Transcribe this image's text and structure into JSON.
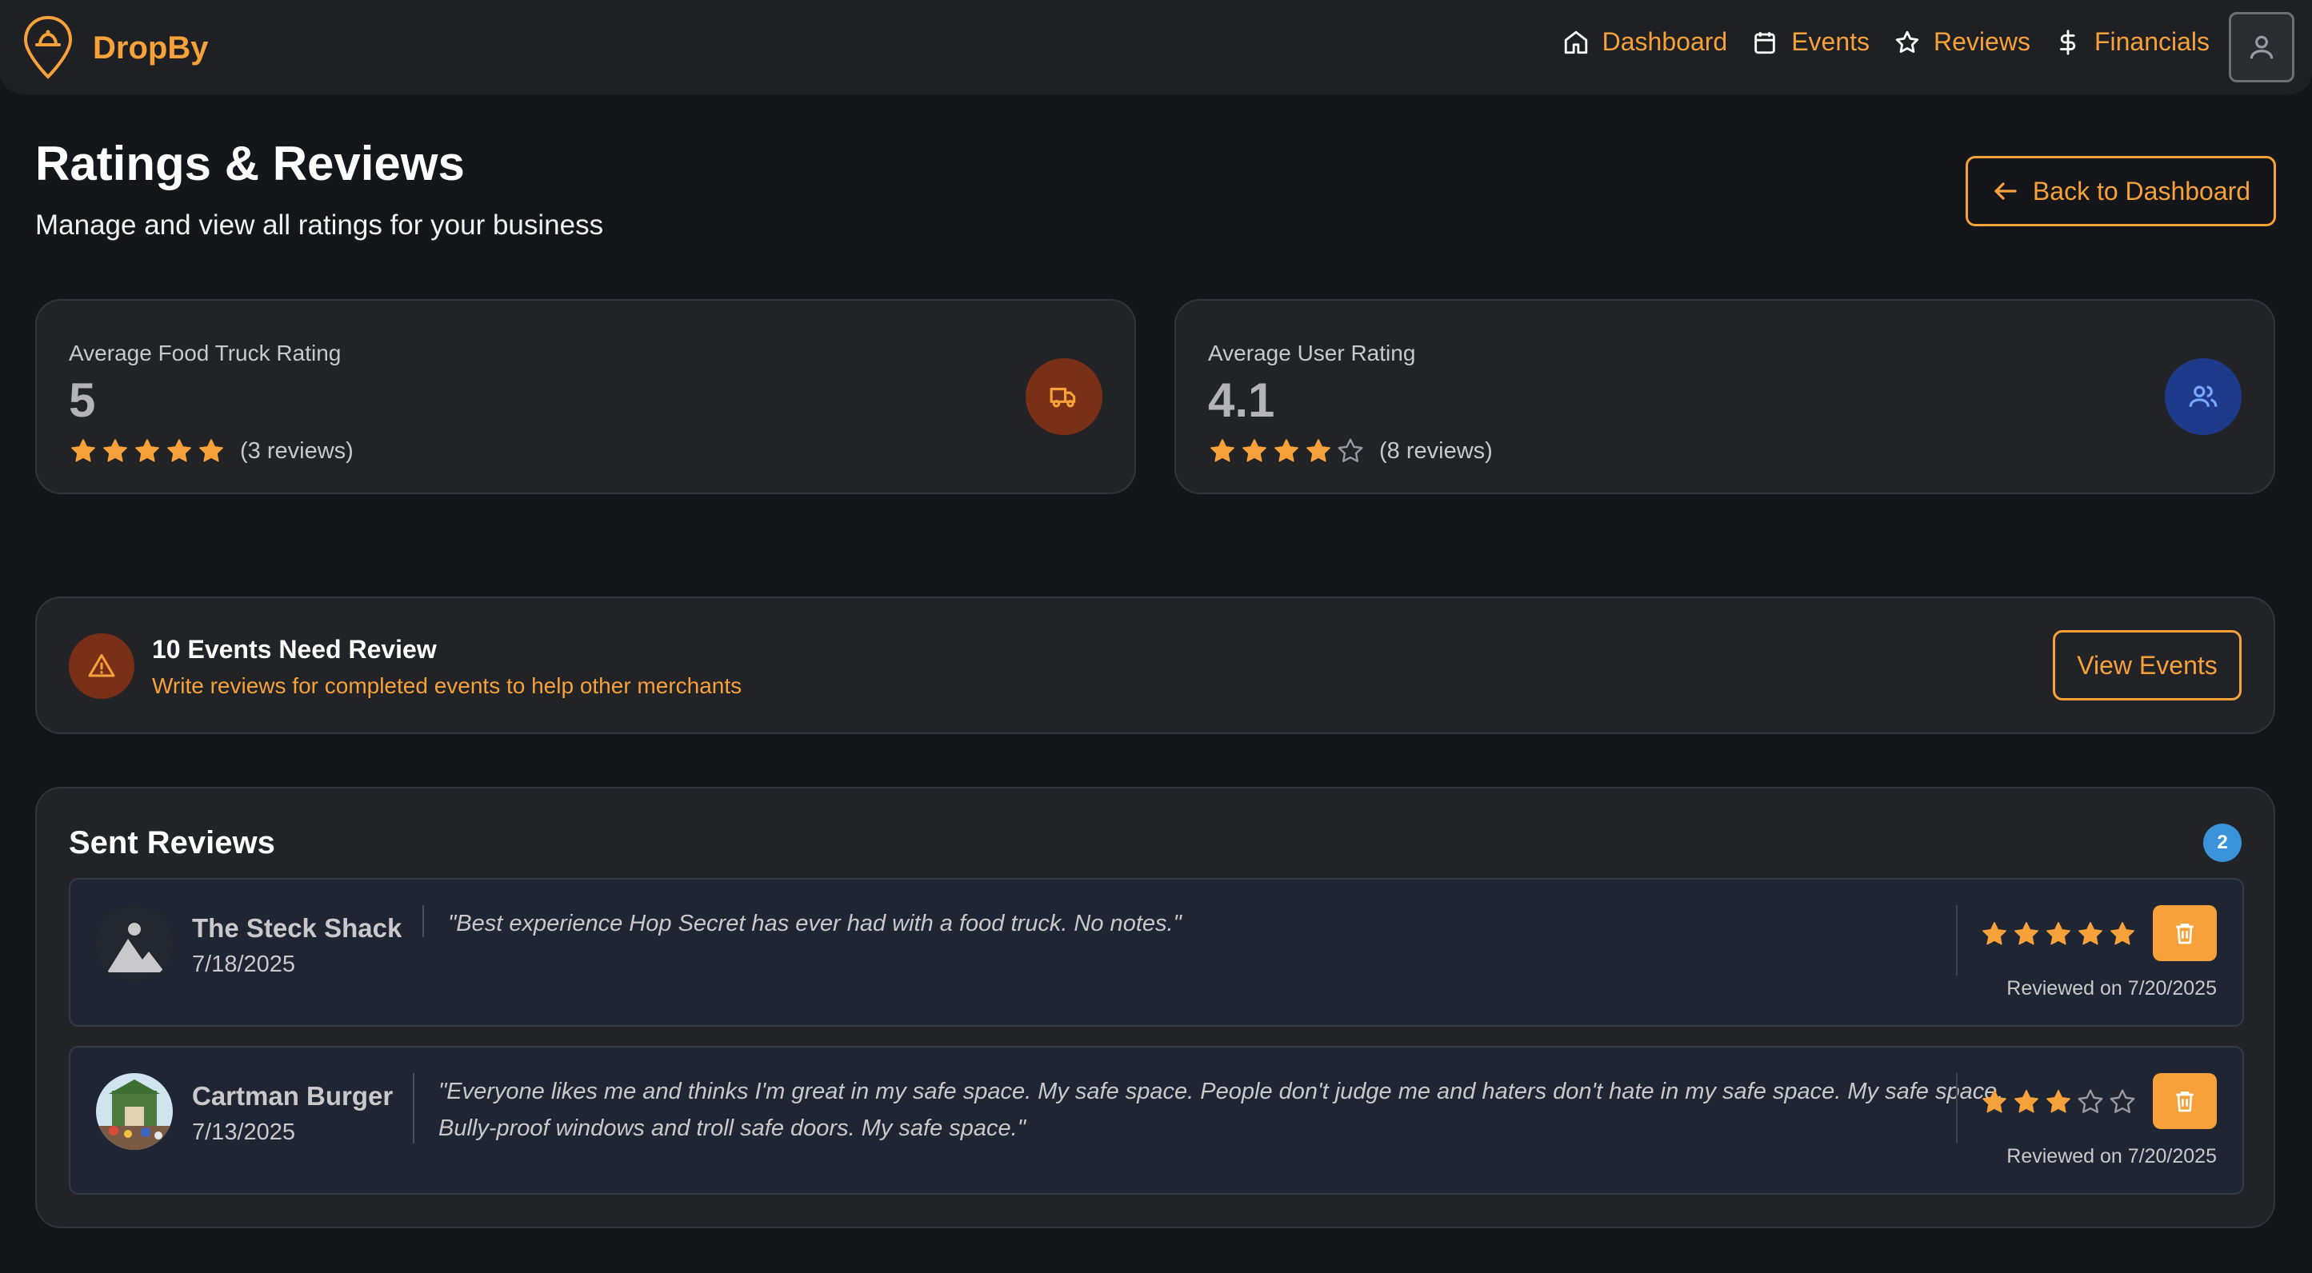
{
  "app": {
    "name": "DropBy"
  },
  "nav": {
    "items": [
      {
        "label": "Dashboard",
        "icon": "home-icon"
      },
      {
        "label": "Events",
        "icon": "calendar-icon"
      },
      {
        "label": "Reviews",
        "icon": "star-icon"
      },
      {
        "label": "Financials",
        "icon": "dollar-icon"
      }
    ]
  },
  "header": {
    "title": "Ratings & Reviews",
    "subtitle": "Manage and view all ratings for your business",
    "back_label": "Back to Dashboard"
  },
  "stats": {
    "food_truck": {
      "label": "Average Food Truck Rating",
      "value": "5",
      "rating": 5,
      "reviews": "(3 reviews)",
      "icon": "truck-icon"
    },
    "user": {
      "label": "Average User Rating",
      "value": "4.1",
      "rating": 4,
      "reviews": "(8 reviews)",
      "icon": "users-icon"
    }
  },
  "alert": {
    "title": "10 Events Need Review",
    "subtitle": "Write reviews for completed events to help other merchants",
    "button_label": "View Events",
    "icon": "warning-icon"
  },
  "sent_reviews": {
    "title": "Sent Reviews",
    "count": "2",
    "items": [
      {
        "name": "The Steck Shack",
        "date": "7/18/2025",
        "text": "\"Best experience Hop Secret has ever had with a food truck. No notes.\"",
        "rating": 5,
        "reviewed_on": "Reviewed on 7/20/2025"
      },
      {
        "name": "Cartman Burger",
        "date": "7/13/2025",
        "text": "\"Everyone likes me and thinks I'm great in my safe space. My safe space. People don't judge me and haters don't hate in my safe space. My safe space. Bully-proof windows and troll safe doors. My safe space.\"",
        "rating": 3,
        "reviewed_on": "Reviewed on 7/20/2025"
      }
    ]
  },
  "colors": {
    "accent": "#f6a13a",
    "background": "#151619",
    "card": "#222327",
    "badge_blue": "#3b94d9",
    "truck_circle": "#7a2f17",
    "users_circle": "#1e3a8a"
  }
}
